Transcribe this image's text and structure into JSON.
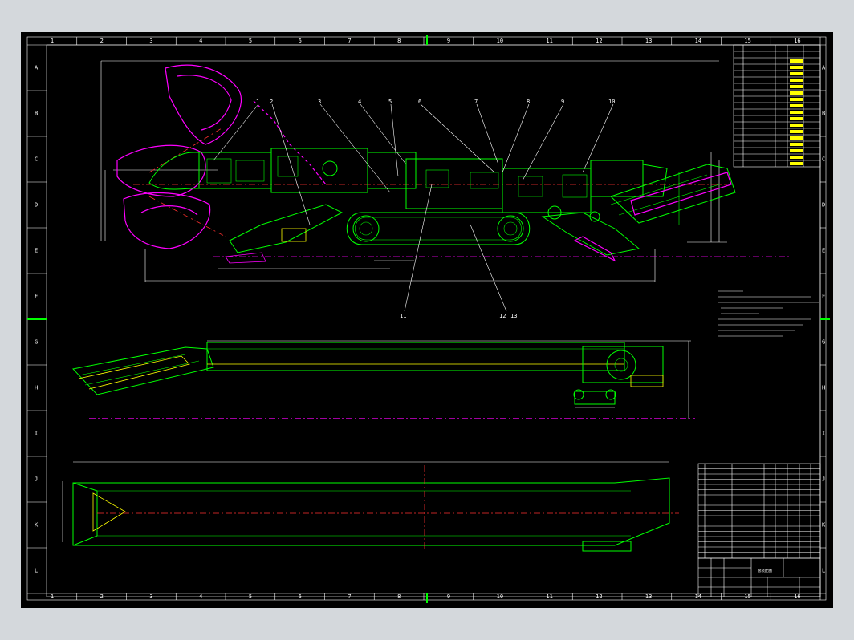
{
  "border": {
    "columns": [
      "1",
      "2",
      "3",
      "4",
      "5",
      "6",
      "7",
      "8",
      "9",
      "10",
      "11",
      "12",
      "13",
      "14",
      "15",
      "16"
    ],
    "rows": [
      "A",
      "B",
      "C",
      "D",
      "E",
      "F",
      "G",
      "H",
      "I",
      "J",
      "K",
      "L"
    ]
  },
  "callouts": {
    "top": [
      "1",
      "2",
      "3",
      "4",
      "5",
      "6",
      "7",
      "8",
      "9",
      "10"
    ],
    "bottom": [
      "11",
      "12",
      "13"
    ]
  },
  "title_block": {
    "drawing_title": "总装配图"
  },
  "colors": {
    "background": "#000000",
    "frame": "#ffffff",
    "structure": "#00ff00",
    "cutting_head": "#ff00ff",
    "centerline": "#ff3030",
    "dimension": "#ffffff",
    "text_highlight": "#ffff00"
  }
}
